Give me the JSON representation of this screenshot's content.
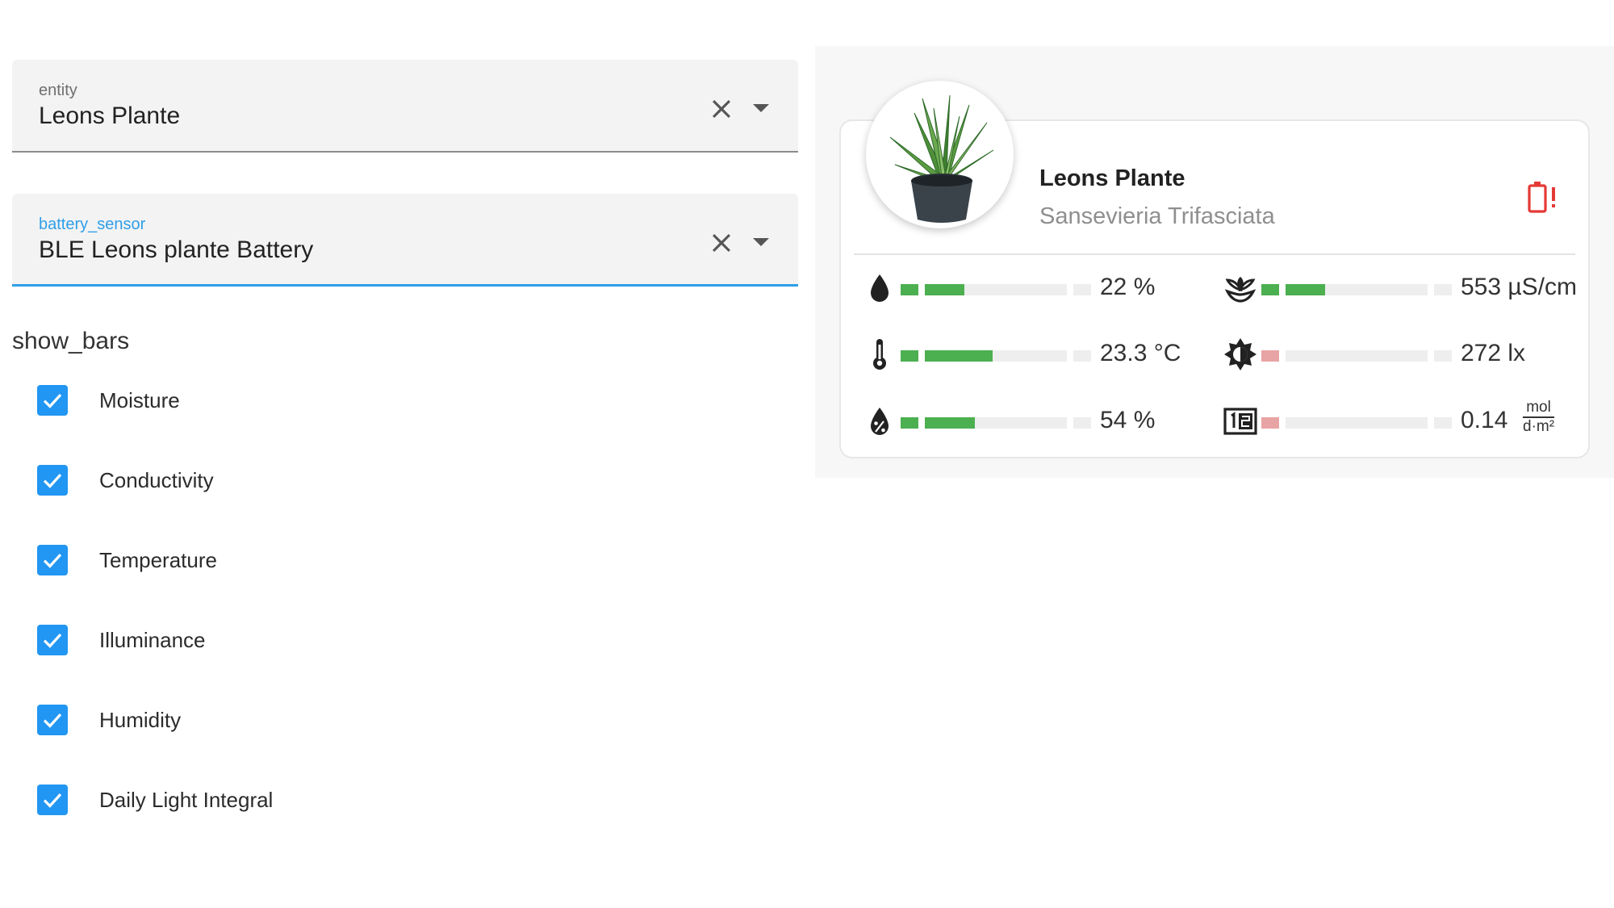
{
  "editor": {
    "entity": {
      "label": "entity",
      "value": "Leons Plante"
    },
    "battery_sensor": {
      "label": "battery_sensor",
      "value": "BLE Leons plante Battery"
    },
    "show_bars_label": "show_bars",
    "checkboxes": [
      {
        "label": "Moisture",
        "checked": true
      },
      {
        "label": "Conductivity",
        "checked": true
      },
      {
        "label": "Temperature",
        "checked": true
      },
      {
        "label": "Illuminance",
        "checked": true
      },
      {
        "label": "Humidity",
        "checked": true
      },
      {
        "label": "Daily Light Integral",
        "checked": true
      }
    ]
  },
  "card": {
    "name": "Leons Plante",
    "species": "Sansevieria Trifasciata",
    "battery_icon": "battery-alert-icon",
    "metrics": [
      {
        "key": "moisture",
        "icon": "water-drop-icon",
        "value_text": "22 %",
        "fill": 0.28,
        "color": "#4caf50"
      },
      {
        "key": "conductivity",
        "icon": "sprout-icon",
        "value_text": "553 µS/cm",
        "fill": 0.28,
        "color": "#4caf50"
      },
      {
        "key": "temperature",
        "icon": "thermometer-icon",
        "value_text": "23.3 °C",
        "fill": 0.48,
        "color": "#4caf50"
      },
      {
        "key": "illuminance",
        "icon": "brightness-icon",
        "value_text": "272 lx",
        "fill": 0.0,
        "color": "#e8a4a4"
      },
      {
        "key": "humidity",
        "icon": "water-percent-icon",
        "value_text": "54 %",
        "fill": 0.35,
        "color": "#4caf50"
      },
      {
        "key": "dli",
        "icon": "counter-icon",
        "value_text": "0.14",
        "unit_num": "mol",
        "unit_den": "d·m²",
        "fill": 0.0,
        "color": "#e8a4a4"
      }
    ]
  },
  "colors": {
    "accent": "#2196f3",
    "good": "#4caf50",
    "bad": "#e8a4a4",
    "battery_alert": "#e53935"
  }
}
